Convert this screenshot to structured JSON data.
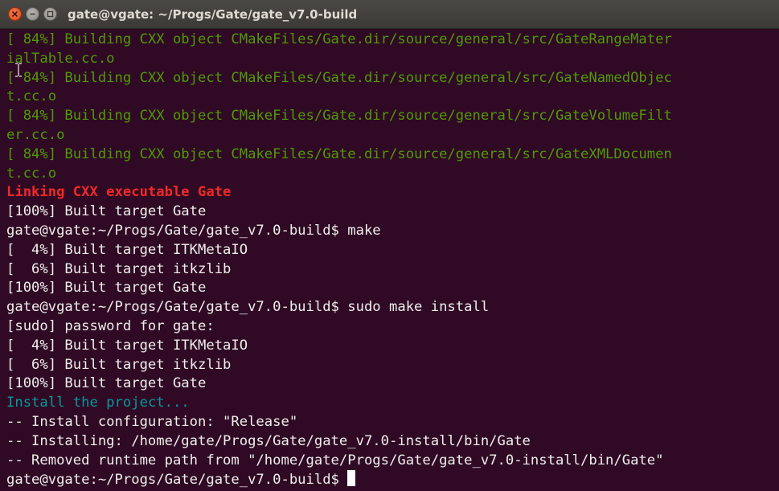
{
  "window": {
    "title": "gate@vgate: ~/Progs/Gate/gate_v7.0-build"
  },
  "terminal": {
    "lines": [
      {
        "color": "green",
        "text": "[ 84%] Building CXX object CMakeFiles/Gate.dir/source/general/src/GateRangeMater"
      },
      {
        "color": "green",
        "text": "ialTable.cc.o"
      },
      {
        "color": "green",
        "text": "[ 84%] Building CXX object CMakeFiles/Gate.dir/source/general/src/GateNamedObjec"
      },
      {
        "color": "green",
        "text": "t.cc.o"
      },
      {
        "color": "green",
        "text": "[ 84%] Building CXX object CMakeFiles/Gate.dir/source/general/src/GateVolumeFilt"
      },
      {
        "color": "green",
        "text": "er.cc.o"
      },
      {
        "color": "green",
        "text": "[ 84%] Building CXX object CMakeFiles/Gate.dir/source/general/src/GateXMLDocumen"
      },
      {
        "color": "green",
        "text": "t.cc.o"
      },
      {
        "color": "red",
        "text": "Linking CXX executable Gate"
      },
      {
        "color": "normal",
        "text": "[100%] Built target Gate"
      },
      {
        "color": "normal",
        "text": "gate@vgate:~/Progs/Gate/gate_v7.0-build$ make"
      },
      {
        "color": "normal",
        "text": "[  4%] Built target ITKMetaIO"
      },
      {
        "color": "normal",
        "text": "[  6%] Built target itkzlib"
      },
      {
        "color": "normal",
        "text": "[100%] Built target Gate"
      },
      {
        "color": "normal",
        "text": "gate@vgate:~/Progs/Gate/gate_v7.0-build$ sudo make install"
      },
      {
        "color": "normal",
        "text": "[sudo] password for gate:"
      },
      {
        "color": "normal",
        "text": "[  4%] Built target ITKMetaIO"
      },
      {
        "color": "normal",
        "text": "[  6%] Built target itkzlib"
      },
      {
        "color": "normal",
        "text": "[100%] Built target Gate"
      },
      {
        "color": "cyan",
        "text": "Install the project..."
      },
      {
        "color": "normal",
        "text": "-- Install configuration: \"Release\""
      },
      {
        "color": "normal",
        "text": "-- Installing: /home/gate/Progs/Gate/gate_v7.0-install/bin/Gate"
      },
      {
        "color": "normal",
        "text": "-- Removed runtime path from \"/home/gate/Progs/Gate/gate_v7.0-install/bin/Gate\""
      }
    ],
    "prompt": "gate@vgate:~/Progs/Gate/gate_v7.0-build$ "
  },
  "colors": {
    "background": "#300a24",
    "green": "#4e9a06",
    "red": "#ef2929",
    "cyan": "#06989a",
    "normal": "#eeeeec"
  }
}
